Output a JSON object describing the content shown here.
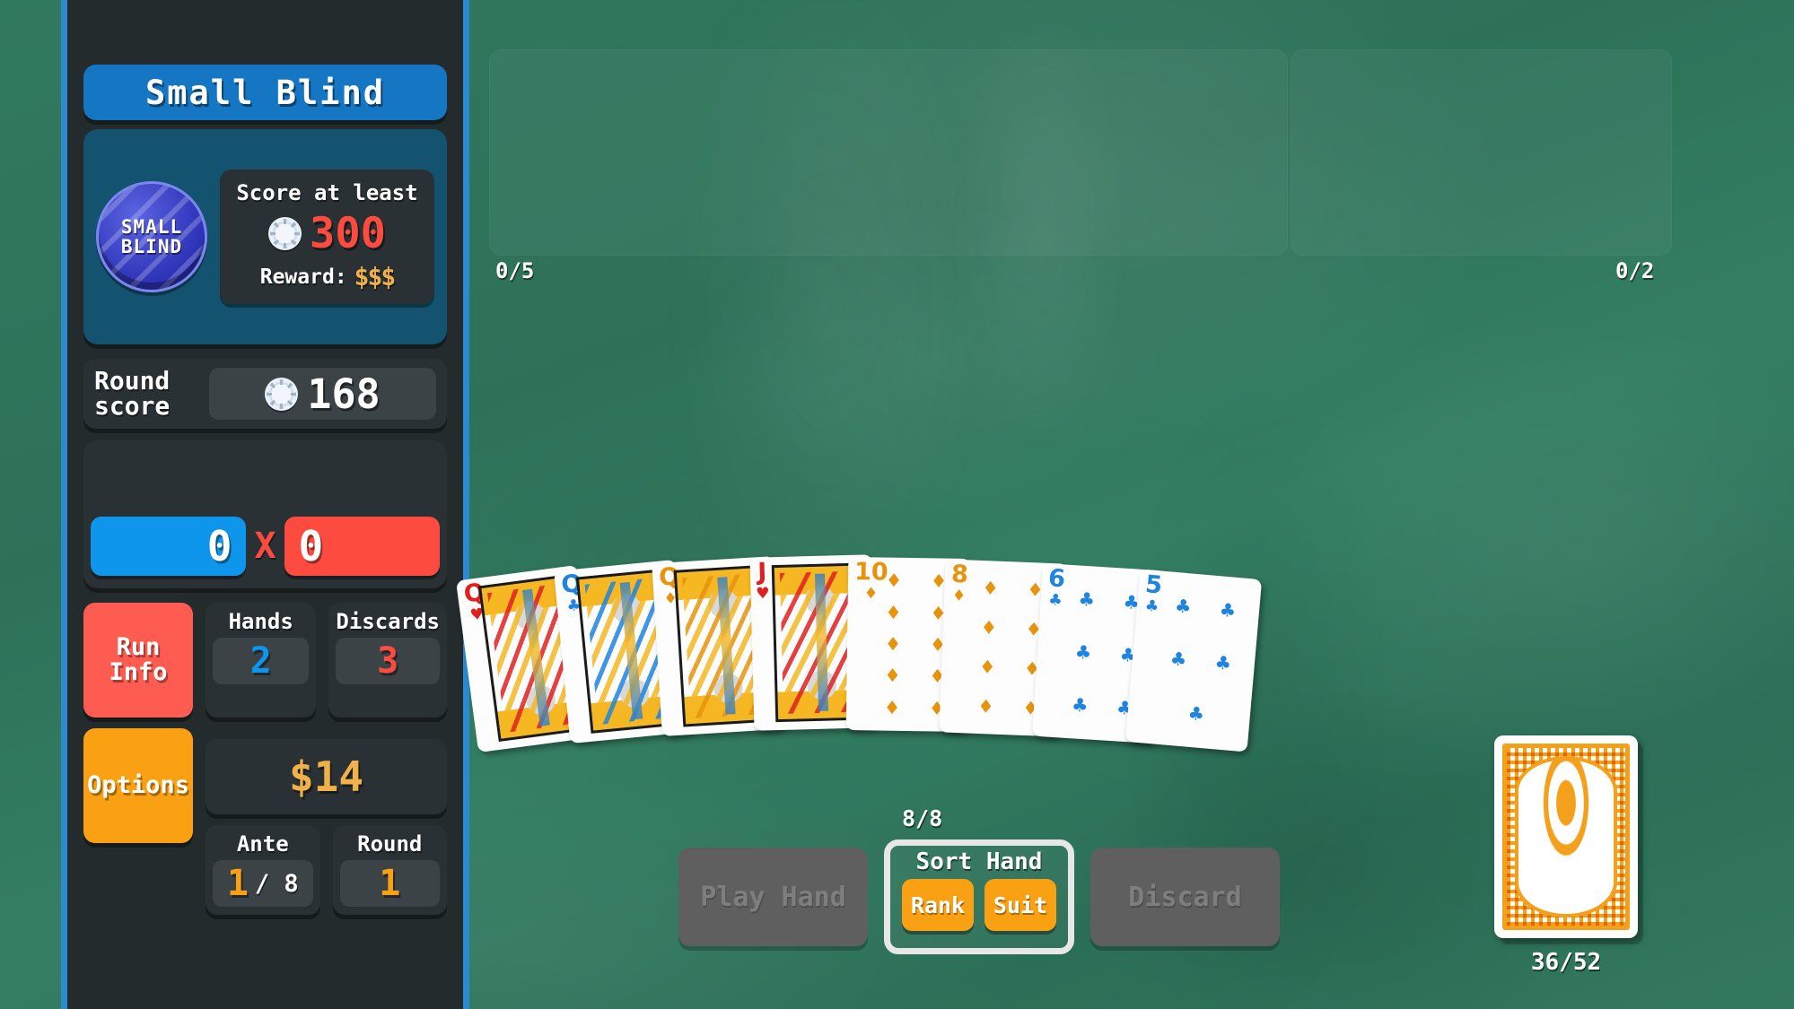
{
  "blind": {
    "name": "Small Blind",
    "chip_label_line1": "SMALL",
    "chip_label_line2": "BLIND",
    "requirement_label": "Score at least",
    "requirement_value": "300",
    "reward_label": "Reward:",
    "reward_value": "$$$"
  },
  "round_score": {
    "label_line1": "Round",
    "label_line2": "score",
    "value": "168"
  },
  "scoring": {
    "chips": "0",
    "operator": "X",
    "mult": "0"
  },
  "buttons": {
    "run_info_line1": "Run",
    "run_info_line2": "Info",
    "options": "Options",
    "play_hand": "Play Hand",
    "discard": "Discard",
    "sort_hand_title": "Sort Hand",
    "sort_rank": "Rank",
    "sort_suit": "Suit"
  },
  "stats": {
    "hands_label": "Hands",
    "hands_value": "2",
    "discards_label": "Discards",
    "discards_value": "3",
    "money": "$14",
    "ante_label": "Ante",
    "ante_value": "1",
    "ante_max": "/ 8",
    "round_label": "Round",
    "round_value": "1"
  },
  "slots": {
    "joker_count": "0/5",
    "consumable_count": "0/2"
  },
  "hand": {
    "count": "8/8",
    "cards": [
      {
        "rank": "Q",
        "suit": "♥",
        "color": "red",
        "type": "face"
      },
      {
        "rank": "Q",
        "suit": "♣",
        "color": "blue",
        "type": "face"
      },
      {
        "rank": "Q",
        "suit": "♦",
        "color": "orng",
        "type": "face"
      },
      {
        "rank": "J",
        "suit": "♥",
        "color": "red",
        "type": "face"
      },
      {
        "rank": "10",
        "suit": "♦",
        "color": "orng",
        "type": "pip",
        "pips": 10
      },
      {
        "rank": "8",
        "suit": "♦",
        "color": "orng",
        "type": "pip",
        "pips": 8
      },
      {
        "rank": "6",
        "suit": "♣",
        "color": "blue",
        "type": "pip",
        "pips": 6
      },
      {
        "rank": "5",
        "suit": "♣",
        "color": "blue",
        "type": "pip",
        "pips": 5
      }
    ]
  },
  "deck": {
    "count": "36/52"
  },
  "colors": {
    "felt": "#2f775e",
    "sidebar": "#232b2d",
    "sidebar_border": "#2c8ad3",
    "blind_blue": "#1577c4",
    "blind_panel": "#13536f",
    "chips_blue": "#0d96ec",
    "mult_red": "#fe4b40",
    "orange": "#f9a013",
    "money_gold": "#f0b04a",
    "run_info_red": "#fe5c51"
  }
}
